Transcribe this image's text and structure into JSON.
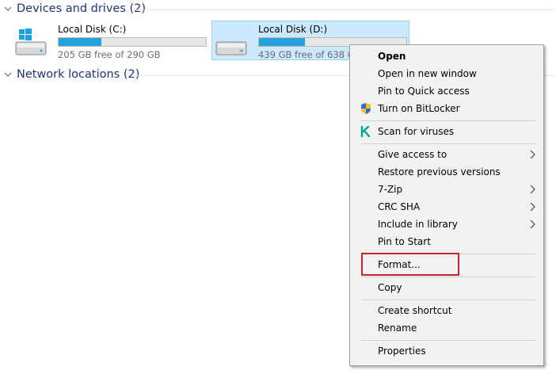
{
  "groups": {
    "devices": {
      "title": "Devices and drives (2)"
    },
    "network": {
      "title": "Network locations (2)"
    }
  },
  "drives": [
    {
      "name": "Local Disk (C:)",
      "free_text": "205 GB free of 290 GB",
      "used_fraction": 0.293,
      "icon": "windows-drive-icon",
      "selected": false
    },
    {
      "name": "Local Disk (D:)",
      "free_text": "439 GB free of 638 GB",
      "used_fraction": 0.312,
      "icon": "drive-icon",
      "selected": true
    }
  ],
  "context_menu": {
    "items": [
      {
        "label": "Open",
        "bold": true
      },
      {
        "label": "Open in new window"
      },
      {
        "label": "Pin to Quick access"
      },
      {
        "label": "Turn on BitLocker",
        "icon": "shield-icon"
      },
      {
        "label": "Scan for viruses",
        "icon": "kaspersky-icon"
      },
      {
        "label": "Give access to",
        "submenu": true
      },
      {
        "label": "Restore previous versions"
      },
      {
        "label": "7-Zip",
        "submenu": true
      },
      {
        "label": "CRC SHA",
        "submenu": true
      },
      {
        "label": "Include in library",
        "submenu": true
      },
      {
        "label": "Pin to Start"
      },
      {
        "label": "Format...",
        "highlighted": true
      },
      {
        "label": "Copy"
      },
      {
        "label": "Create shortcut"
      },
      {
        "label": "Rename"
      },
      {
        "label": "Properties"
      }
    ]
  },
  "colors": {
    "accent": "#1e3287",
    "selection_bg": "#cce8ff",
    "bar_fill": "#26a0da",
    "highlight_box": "#d0212f",
    "kaspersky_green": "#00a88e"
  }
}
